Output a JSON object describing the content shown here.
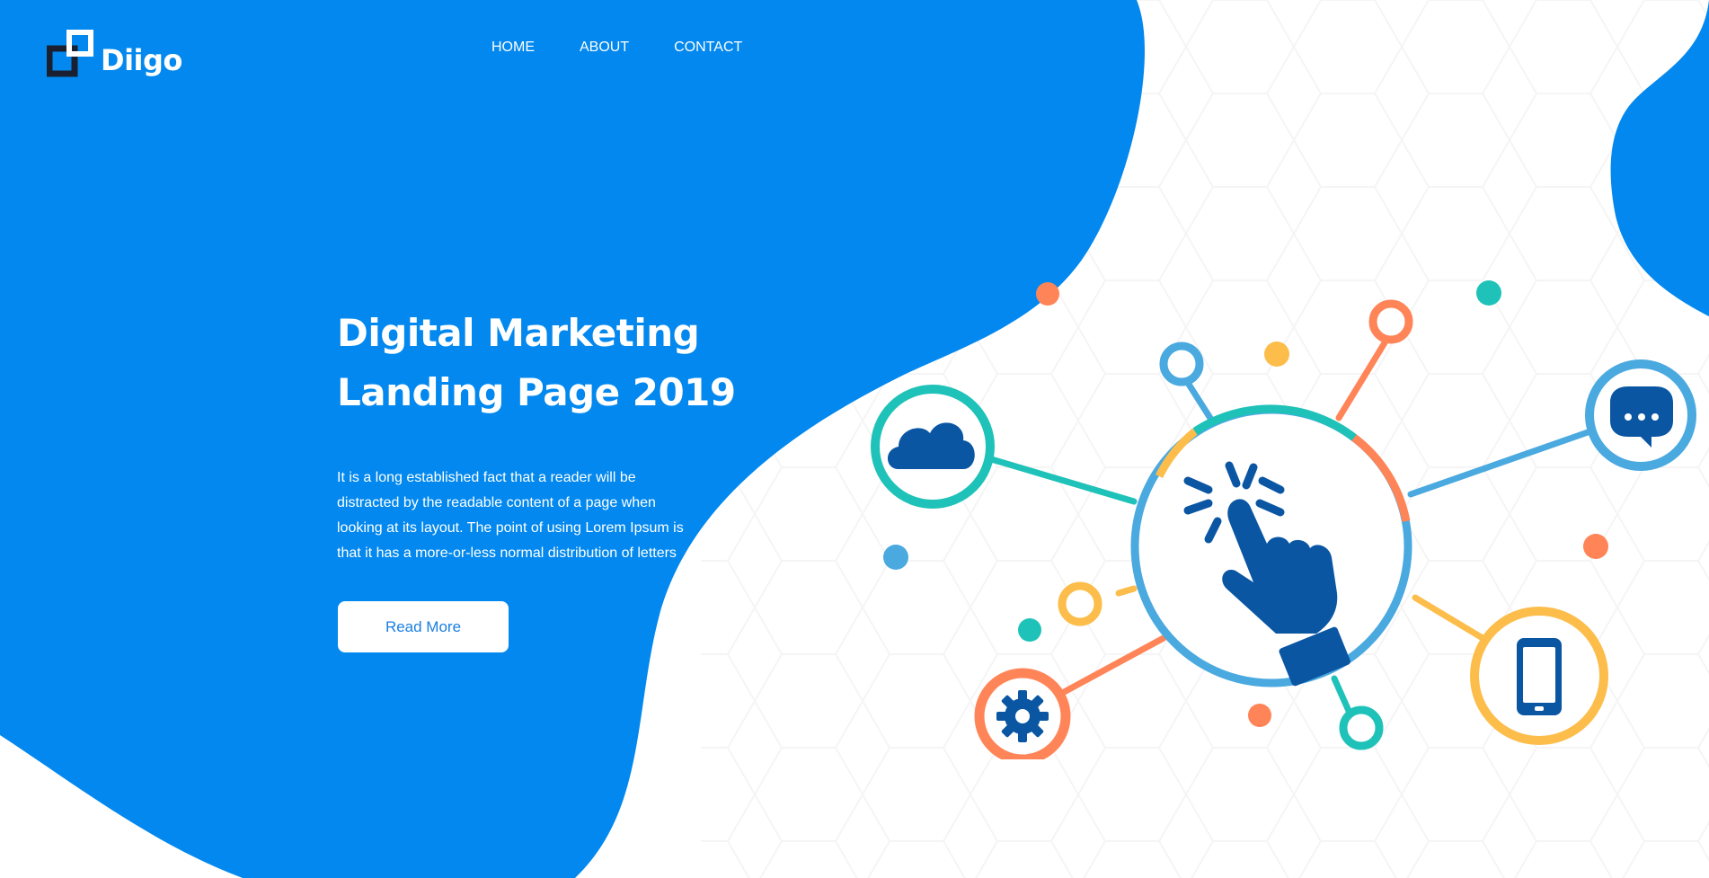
{
  "brand": {
    "name": "Diigo"
  },
  "nav": {
    "items": [
      "HOME",
      "ABOUT",
      "CONTACT"
    ]
  },
  "hero": {
    "title_line1": "Digital Marketing",
    "title_line2": "Landing Page 2019",
    "description_lines": [
      "It is a long established fact that a reader will be",
      "distracted by the readable content of a page when",
      "looking at its layout. The point of using Lorem Ipsum is",
      "that it has a more-or-less normal distribution of letters"
    ],
    "cta_label": "Read More"
  },
  "illustration": {
    "icons": [
      "cloud-icon",
      "pointer-hand-icon",
      "chat-icon",
      "gear-icon",
      "smartphone-icon"
    ]
  },
  "colors": {
    "primary_blue": "#0288ee",
    "teal": "#1fc2b8",
    "orange": "#ff8457",
    "yellow": "#fcbd4b",
    "light_blue": "#4aa9df",
    "dark_blue": "#0a56a3"
  }
}
